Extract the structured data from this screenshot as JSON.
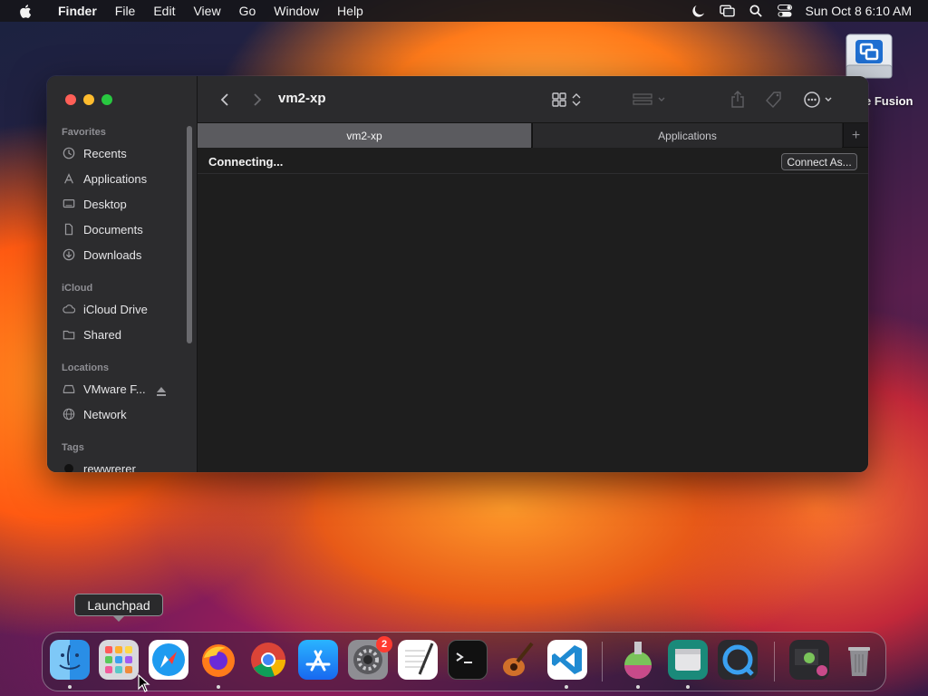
{
  "menubar": {
    "app_name": "Finder",
    "items": [
      "File",
      "Edit",
      "View",
      "Go",
      "Window",
      "Help"
    ],
    "clock": "Sun Oct 8  6:10 AM"
  },
  "desktop": {
    "icon_label": "e Fusion"
  },
  "finder": {
    "title": "vm2-xp",
    "tabs": [
      {
        "label": "vm2-xp",
        "active": true
      },
      {
        "label": "Applications",
        "active": false
      }
    ],
    "tab_add": "+",
    "status": "Connecting...",
    "connect_button": "Connect As...",
    "sidebar": {
      "favorites_header": "Favorites",
      "favorites": [
        "Recents",
        "Applications",
        "Desktop",
        "Documents",
        "Downloads"
      ],
      "icloud_header": "iCloud",
      "icloud": [
        "iCloud Drive",
        "Shared"
      ],
      "locations_header": "Locations",
      "locations": [
        "VMware F...",
        "Network"
      ],
      "tags_header": "Tags",
      "tags": [
        "rewwrerer"
      ]
    }
  },
  "tooltip": {
    "text": "Launchpad"
  },
  "dock": {
    "apps": [
      "Finder",
      "Launchpad",
      "Safari",
      "Firefox",
      "Chrome",
      "App Store",
      "System Settings",
      "TextEdit",
      "Terminal",
      "GarageBand",
      "VS Code",
      "Installer",
      "Migration Assistant",
      "QuickTime Player",
      "Downloads Stack",
      "Trash"
    ],
    "settings_badge": "2"
  },
  "colors": {
    "accent": "#0a84ff",
    "close": "#ff5f57",
    "minimize": "#febc2e",
    "zoom": "#28c840"
  }
}
